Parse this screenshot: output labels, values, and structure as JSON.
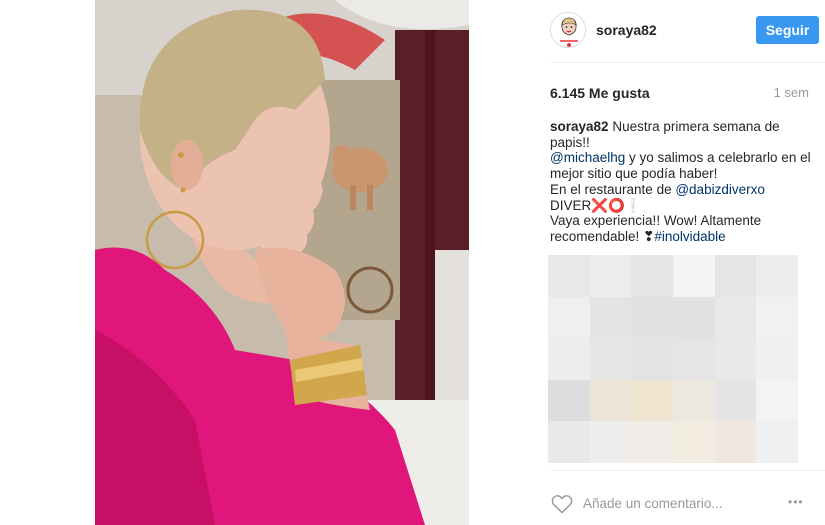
{
  "post": {
    "photo_alt": "",
    "username": "soraya82",
    "follow_label": "Seguir",
    "likes": "6.145 Me gusta",
    "age": "1 sem"
  },
  "caption": {
    "user": "soraya82",
    "line1": " Nuestra primera semana de",
    "line2": "papis!!",
    "line3_mention": "@michaelhg",
    "line3_rest": " y yo salimos a celebrarlo en el",
    "line4": "mejor sitio que podía haber!",
    "line5_text": "En el restaurante de ",
    "line5_mention": "@dabizdiverxo",
    "line6_text": "DIVER",
    "line6_emoji": "❌⭕❕",
    "line7": "Vaya experiencia!! Wow! Altamente",
    "line8_text": "recomendable! ",
    "line8_emoji": "❣",
    "line8_hashtag": "#inolvidable"
  },
  "comment": {
    "placeholder": "Añade un comentario...",
    "more": "•••"
  },
  "icons": {
    "heart": "heart-icon",
    "more": "more-options-icon"
  },
  "colors": {
    "accent": "#3897f0",
    "mention": "#003569",
    "secondary_text": "#999999"
  }
}
